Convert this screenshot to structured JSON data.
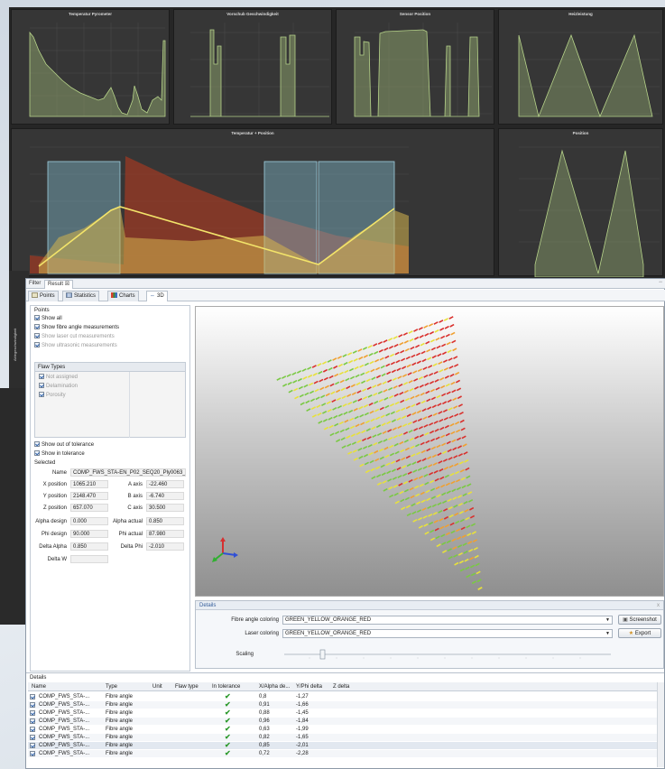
{
  "window": {
    "tab_filter": "Filter",
    "tab_result": "Result",
    "tab_result_close": "☒",
    "tab_menu": "▫▫"
  },
  "subtabs": [
    {
      "label": "Points",
      "icon": "points-icon"
    },
    {
      "label": "Statistics",
      "icon": "statistics-icon"
    },
    {
      "label": "Charts",
      "icon": "charts-icon"
    },
    {
      "label": "3D",
      "icon": "3d-icon"
    }
  ],
  "dashboard": {
    "panels": [
      {
        "title": "Temperatur Pyrometer"
      },
      {
        "title": "Vorschub Geschwindigkeit"
      },
      {
        "title": "Sensor Position"
      },
      {
        "title": "Heizleistung"
      },
      {
        "title": "Temperatur + Position"
      },
      {
        "title": "Position"
      }
    ],
    "side_label": "Ablegeschwindigkeit"
  },
  "points": {
    "title": "Points",
    "show_all": "Show all",
    "show_fibre": "Show fibre angle measurements",
    "show_laser": "Show laser cut measurements",
    "show_ultrasonic": "Show ultrasonic measurements",
    "flaw_types_title": "Flaw Types",
    "flaw_types": [
      "Not assigned",
      "Delamination",
      "Porosity"
    ],
    "show_out": "Show out of tolerance",
    "show_in": "Show in tolerance",
    "selected_title": "Selected"
  },
  "selected": {
    "name_label": "Name",
    "name_value": "COMP_FWS_STA-EN_P02_SEQ20_Ply0063_",
    "x_label": "X position",
    "x_value": "1065.210",
    "y_label": "Y position",
    "y_value": "2148.470",
    "z_label": "Z position",
    "z_value": "657.070",
    "a_label": "A axis",
    "a_value": "-22.460",
    "b_label": "B axis",
    "b_value": "-6.740",
    "c_label": "C axis",
    "c_value": "30.500",
    "alpha_design_label": "Alpha design",
    "alpha_design_value": "0.000",
    "alpha_actual_label": "Alpha actual",
    "alpha_actual_value": "0.850",
    "phi_design_label": "Phi design",
    "phi_design_value": "90.000",
    "phi_actual_label": "Phi actual",
    "phi_actual_value": "87.980",
    "delta_alpha_label": "Delta Alpha",
    "delta_alpha_value": "0.850",
    "delta_phi_label": "Delta Phi",
    "delta_phi_value": "-2.010",
    "delta_w_label": "Delta W",
    "delta_w_value": ""
  },
  "details": {
    "title": "Details",
    "close": "x",
    "fibre_label": "Fibre angle coloring",
    "fibre_value": "GREEN_YELLOW_ORANGE_RED",
    "laser_label": "Laser coloring",
    "laser_value": "GREEN_YELLOW_ORANGE_RED",
    "scaling_label": "Scaling",
    "screenshot": "Screenshot",
    "export": "Export"
  },
  "table": {
    "title": "Details",
    "columns": [
      "Name",
      "Type",
      "Unit",
      "Flaw type",
      "In tolerance",
      "X/Alpha de...",
      "Y/Phi delta",
      "Z delta"
    ],
    "rows": [
      {
        "name": "COMP_FWS_STA-...",
        "type": "Fibre angle",
        "x": "0,8",
        "y": "-1,27"
      },
      {
        "name": "COMP_FWS_STA-...",
        "type": "Fibre angle",
        "x": "0,91",
        "y": "-1,66"
      },
      {
        "name": "COMP_FWS_STA-...",
        "type": "Fibre angle",
        "x": "0,88",
        "y": "-1,45"
      },
      {
        "name": "COMP_FWS_STA-...",
        "type": "Fibre angle",
        "x": "0,96",
        "y": "-1,84"
      },
      {
        "name": "COMP_FWS_STA-...",
        "type": "Fibre angle",
        "x": "0,63",
        "y": "-1,99"
      },
      {
        "name": "COMP_FWS_STA-...",
        "type": "Fibre angle",
        "x": "0,82",
        "y": "-1,65"
      },
      {
        "name": "COMP_FWS_STA-...",
        "type": "Fibre angle",
        "x": "0,85",
        "y": "-2,01"
      },
      {
        "name": "COMP_FWS_STA-...",
        "type": "Fibre angle",
        "x": "0,72",
        "y": "-2,28"
      }
    ]
  },
  "colors": {
    "green": "#7ac943",
    "yellow": "#e8e13a",
    "orange": "#f0a030",
    "red": "#d9302c",
    "accent": "#335c9a"
  }
}
